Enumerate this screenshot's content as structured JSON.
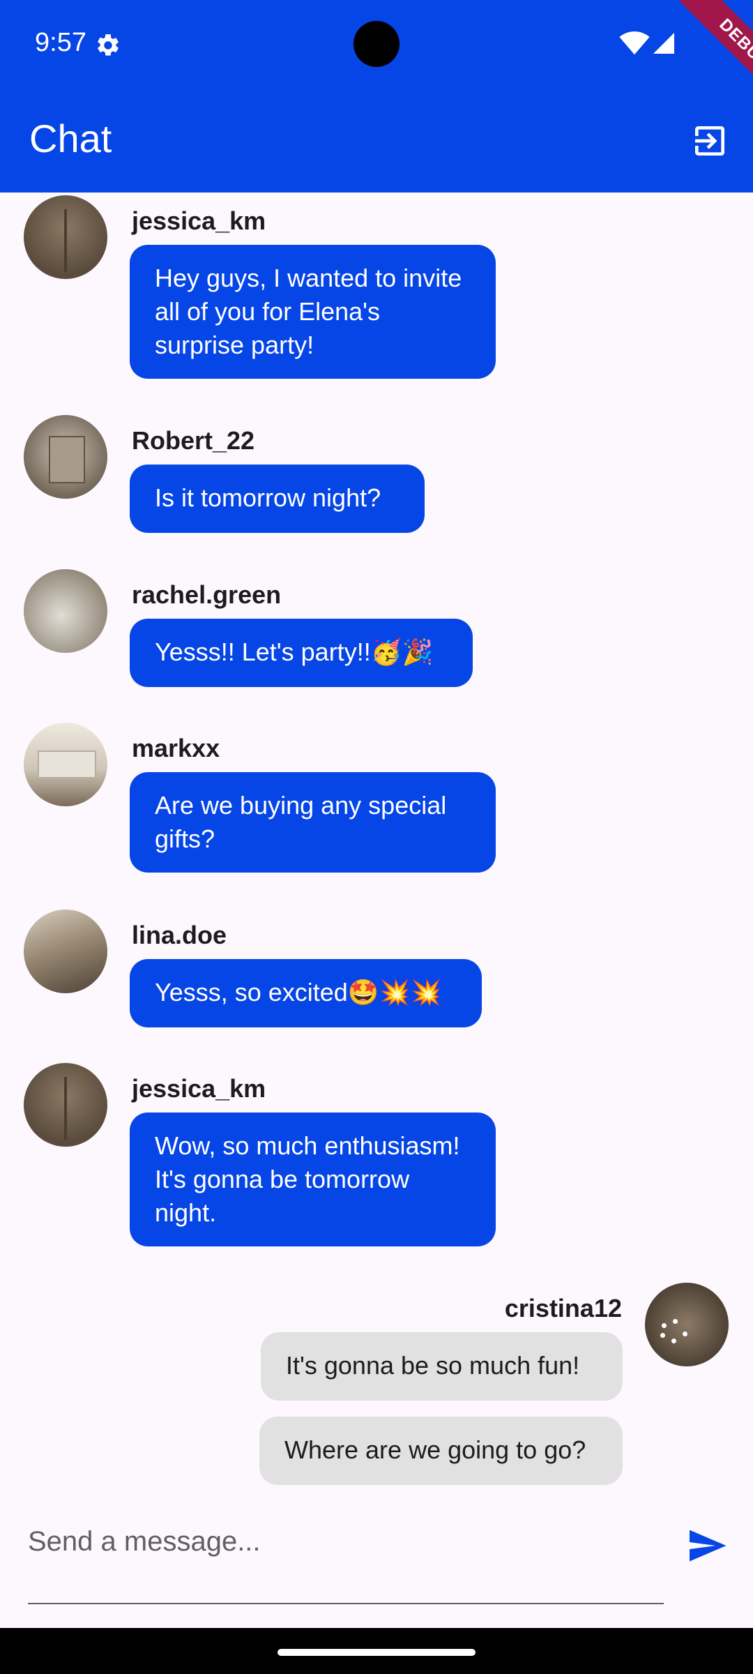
{
  "status": {
    "time": "9:57",
    "debug_label": "DEBUG"
  },
  "appbar": {
    "title": "Chat"
  },
  "messages": [
    {
      "user": "jessica_km",
      "text": "Hey guys, I wanted to invite all of you for Elena's surprise party!"
    },
    {
      "user": "Robert_22",
      "text": "Is it tomorrow night?"
    },
    {
      "user": "rachel.green",
      "text": "Yesss!! Let's party!!🥳🎉"
    },
    {
      "user": "markxx",
      "text": "Are we buying any special gifts?"
    },
    {
      "user": "lina.doe",
      "text": "Yesss, so excited🤩💥💥"
    },
    {
      "user": "jessica_km",
      "text": "Wow, so much enthusiasm! It's gonna be tomorrow night."
    },
    {
      "user": "cristina12",
      "text": "It's gonna be so much fun!"
    },
    {
      "user": "",
      "text": "Where are we going to go?"
    }
  ],
  "composer": {
    "placeholder": "Send a message..."
  },
  "colors": {
    "primary": "#0645e6",
    "own_bubble": "#e1e1e1",
    "background": "#fdf8fd"
  }
}
